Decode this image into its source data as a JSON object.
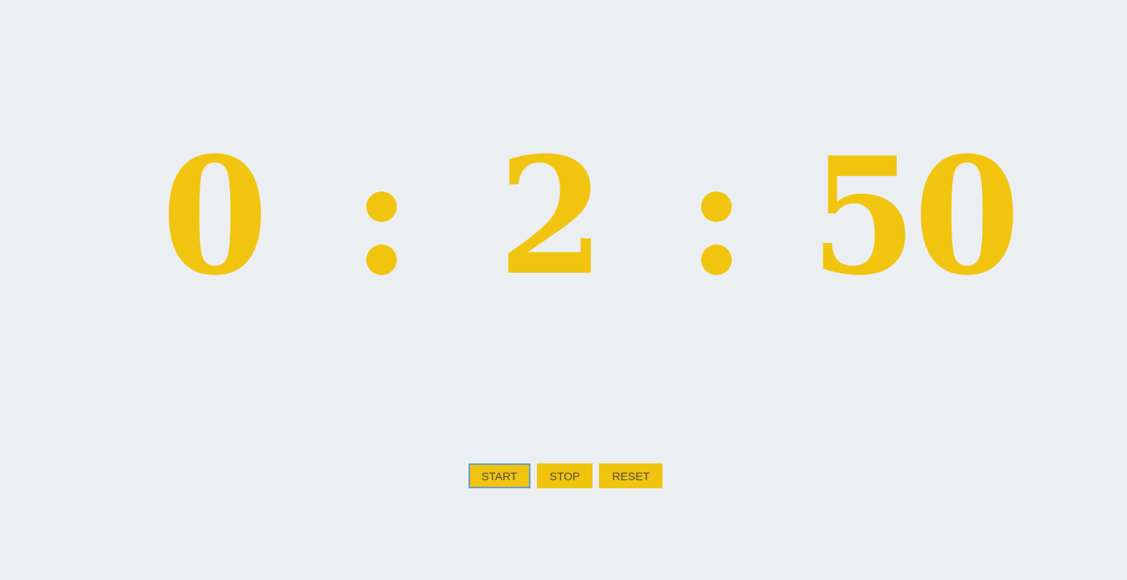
{
  "timer": {
    "hours": "0",
    "separator_1": ":",
    "minutes": "2",
    "separator_2": ":",
    "seconds": "50"
  },
  "controls": {
    "start_label": "START",
    "stop_label": "STOP",
    "reset_label": "RESET"
  },
  "colors": {
    "background": "#ebeff1",
    "accent": "#f1c40f",
    "button_text": "#4a4a4a",
    "focus_ring": "#6f9fc0"
  }
}
